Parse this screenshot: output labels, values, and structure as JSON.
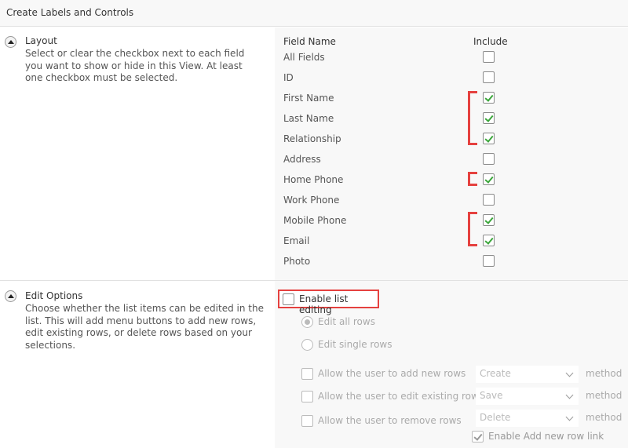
{
  "header": {
    "title": "Create Labels and Controls"
  },
  "layout_section": {
    "title": "Layout",
    "description": "Select or clear the checkbox next to each field you want to show or hide in this View. At least one checkbox must be selected.",
    "col_field_name": "Field Name",
    "col_include": "Include",
    "fields": [
      {
        "label": "All Fields",
        "checked": false
      },
      {
        "label": "ID",
        "checked": false
      },
      {
        "label": "First Name",
        "checked": true
      },
      {
        "label": "Last Name",
        "checked": true
      },
      {
        "label": "Relationship",
        "checked": true
      },
      {
        "label": "Address",
        "checked": false
      },
      {
        "label": "Home Phone",
        "checked": true
      },
      {
        "label": "Work Phone",
        "checked": false
      },
      {
        "label": "Mobile Phone",
        "checked": true
      },
      {
        "label": "Email",
        "checked": true
      },
      {
        "label": "Photo",
        "checked": false
      }
    ]
  },
  "edit_section": {
    "title": "Edit Options",
    "description": "Choose whether the list items can be edited in the list. This will add menu buttons to add new rows, edit existing rows, or delete rows based on your selections.",
    "enable_list_editing": {
      "label": "Enable list editing",
      "checked": false
    },
    "radios": [
      {
        "label": "Edit all rows",
        "selected": true
      },
      {
        "label": "Edit single rows",
        "selected": false
      }
    ],
    "permissions": [
      {
        "label": "Allow the user to add new rows",
        "checked": false,
        "method_value": "Create",
        "method_suffix": "method"
      },
      {
        "label": "Allow the user to edit existing rows",
        "checked": false,
        "method_value": "Save",
        "method_suffix": "method"
      },
      {
        "label": "Allow the user to remove rows",
        "checked": false,
        "method_value": "Delete",
        "method_suffix": "method"
      }
    ],
    "add_new_row_link": {
      "label": "Enable Add new row link",
      "checked": true
    }
  },
  "colors": {
    "highlight": "#e5413f",
    "check": "#3aa63a"
  }
}
